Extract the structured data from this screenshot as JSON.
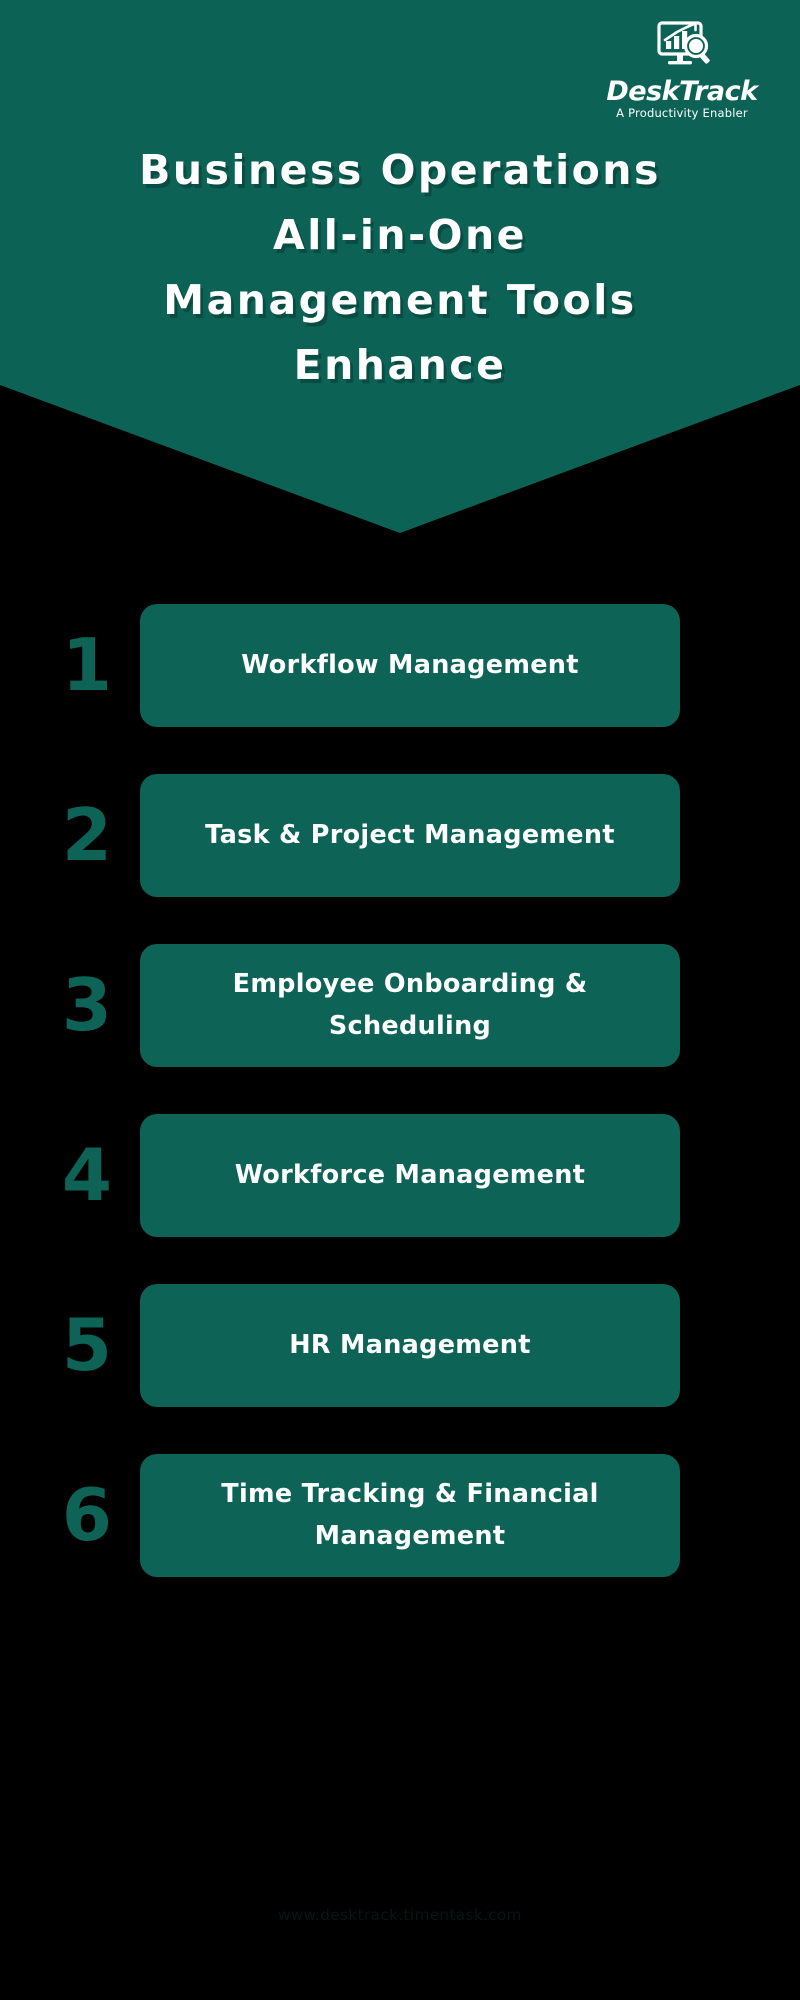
{
  "theme": {
    "background": "#000000",
    "brand_green": "#0C6355",
    "card_green": "#0D6355",
    "text_white": "#FFFFFF",
    "number_green": "#0D6355"
  },
  "header": {
    "logo": {
      "icon": "monitor-analytics-magnifier-icon",
      "name_part_1": "Desk",
      "name_part_2": "Track",
      "tagline": "A Productivity Enabler"
    },
    "title_lines": [
      "Business Operations",
      "All-in-One",
      "Management Tools",
      "Enhance"
    ]
  },
  "list": {
    "items": [
      {
        "number": "1",
        "label": "Workflow Management"
      },
      {
        "number": "2",
        "label": "Task & Project Management"
      },
      {
        "number": "3",
        "label": "Employee Onboarding & Scheduling"
      },
      {
        "number": "4",
        "label": "Workforce Management"
      },
      {
        "number": "5",
        "label": "HR Management"
      },
      {
        "number": "6",
        "label": "Time Tracking & Financial Management"
      }
    ]
  },
  "footer": {
    "text": "www.desktrack.timentask.com"
  }
}
